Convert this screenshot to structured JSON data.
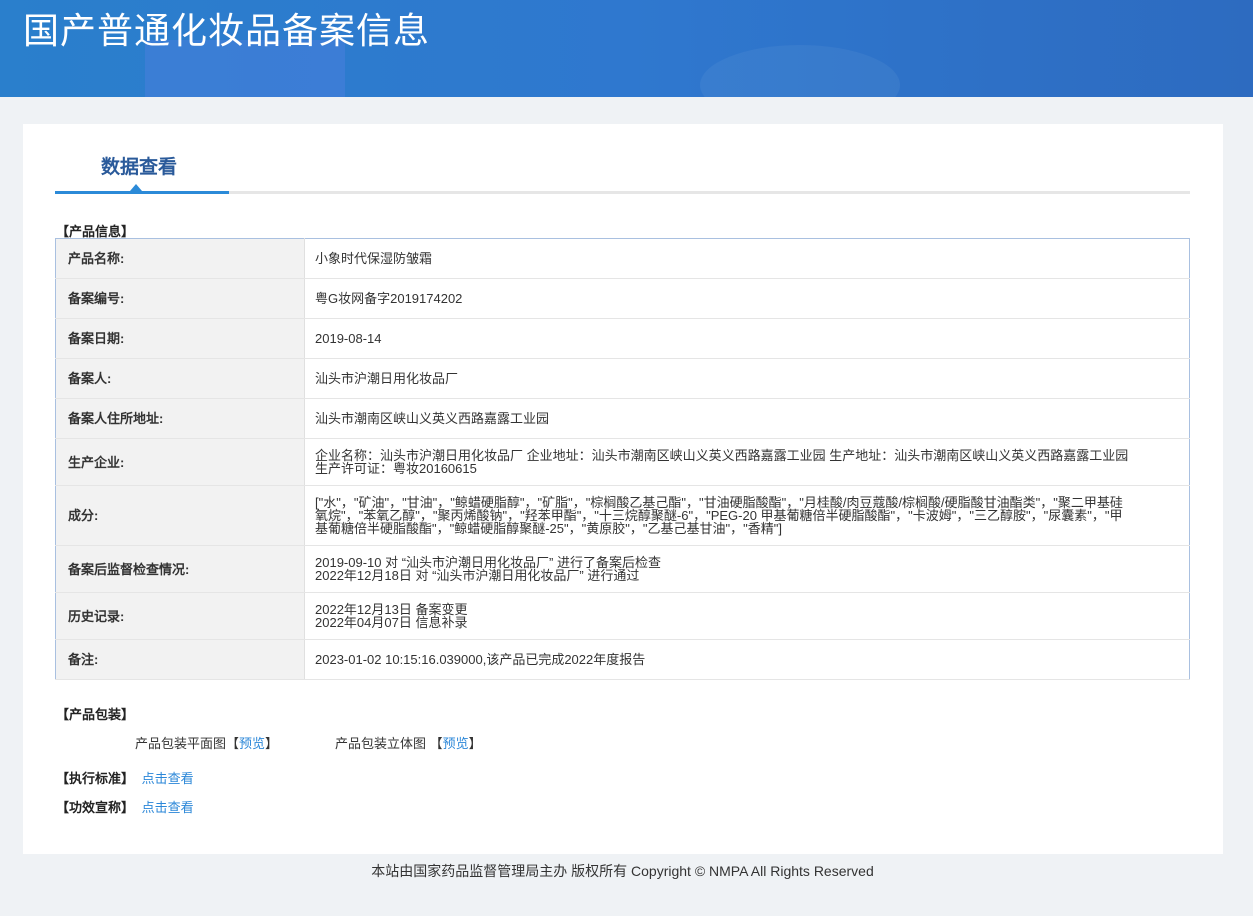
{
  "header": {
    "title": "国产普通化妆品备案信息"
  },
  "tabs": [
    {
      "label": "数据查看"
    }
  ],
  "product_info": {
    "heading": "【产品信息】",
    "rows": [
      {
        "label": "产品名称:",
        "value": [
          "小象时代保湿防皱霜"
        ]
      },
      {
        "label": "备案编号:",
        "value": [
          "粤G妆网备字2019174202"
        ]
      },
      {
        "label": "备案日期:",
        "value": [
          "2019-08-14"
        ]
      },
      {
        "label": "备案人:",
        "value": [
          "汕头市沪潮日用化妆品厂"
        ]
      },
      {
        "label": "备案人住所地址:",
        "value": [
          "汕头市潮南区峡山义英义西路嘉露工业园"
        ]
      },
      {
        "label": "生产企业:",
        "value": [
          "企业名称：汕头市沪潮日用化妆品厂 企业地址：汕头市潮南区峡山义英义西路嘉露工业园 生产地址：汕头市潮南区峡山义英义西路嘉露工业园 生产许可证：粤妆20160615"
        ]
      },
      {
        "label": "成分:",
        "value": [
          "[\"水\"，\"矿油\"，\"甘油\"，\"鲸蜡硬脂醇\"，\"矿脂\"，\"棕榈酸乙基己酯\"，\"甘油硬脂酸酯\"，\"月桂酸/肉豆蔻酸/棕榈酸/硬脂酸甘油酯类\"，\"聚二甲基硅氧烷\"，\"苯氧乙醇\"，\"聚丙烯酸钠\"，\"羟苯甲酯\"，\"十三烷醇聚醚-6\"，\"PEG-20 甲基葡糖倍半硬脂酸酯\"，\"卡波姆\"，\"三乙醇胺\"，\"尿囊素\"，\"甲基葡糖倍半硬脂酸酯\"，\"鲸蜡硬脂醇聚醚-25\"，\"黄原胶\"，\"乙基己基甘油\"，\"香精\"]"
        ]
      },
      {
        "label": "备案后监督检查情况:",
        "value": [
          "2019-09-10 对 “汕头市沪潮日用化妆品厂” 进行了备案后检查",
          "2022年12月18日 对 “汕头市沪潮日用化妆品厂” 进行通过"
        ]
      },
      {
        "label": "历史记录:",
        "value": [
          "2022年12月13日 备案变更",
          "2022年04月07日 信息补录"
        ]
      },
      {
        "label": "备注:",
        "value": [
          "2023-01-02 10:15:16.039000,该产品已完成2022年度报告"
        ]
      }
    ]
  },
  "packaging": {
    "heading": "【产品包装】",
    "flat_label": "产品包装平面图",
    "solid_label": "产品包装立体图",
    "open": "【",
    "close": "】",
    "preview": "预览"
  },
  "standard": {
    "heading": "【执行标准】",
    "link": "点击查看"
  },
  "efficacy": {
    "heading": "【功效宣称】",
    "link": "点击查看"
  },
  "footer": {
    "text": "本站由国家药品监督管理局主办 版权所有 Copyright © NMPA All Rights Reserved"
  }
}
